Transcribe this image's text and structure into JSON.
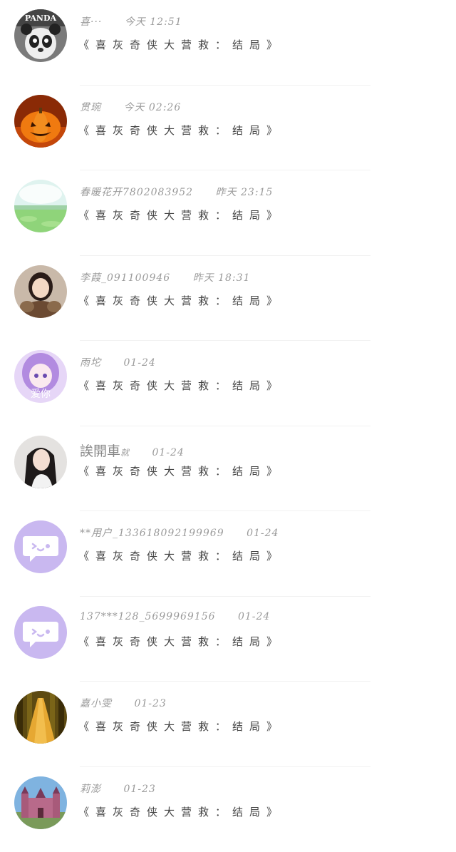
{
  "items": [
    {
      "name": "喜···",
      "time": "今天 12:51",
      "title": "《喜灰奇侠大营救：结局》",
      "avatar_icon": "panda-avatar-icon",
      "avatar_text": "PANDA"
    },
    {
      "name": "贯琬",
      "time": "今天 02:26",
      "title": "《喜灰奇侠大营救：结局》",
      "avatar_icon": "pumpkin-avatar-icon"
    },
    {
      "name": "春暖花开7802083952",
      "time": "昨天 23:15",
      "title": "《喜灰奇侠大营救：结局》",
      "avatar_icon": "meadow-avatar-icon"
    },
    {
      "name": "李葭_091100946",
      "time": "昨天 18:31",
      "title": "《喜灰奇侠大营救：结局》",
      "avatar_icon": "girl-photo-avatar-icon"
    },
    {
      "name": "雨坨",
      "time": "01-24",
      "title": "《喜灰奇侠大营救：结局》",
      "avatar_icon": "anime-girl-avatar-icon",
      "avatar_text": "爱你"
    },
    {
      "name": "誒開車",
      "name_suffix": "就",
      "time": "01-24",
      "title": "《喜灰奇侠大营救：结局》",
      "avatar_icon": "woman-photo-avatar-icon"
    },
    {
      "name": "**用户_133618092199969",
      "time": "01-24",
      "title": "《喜灰奇侠大营救：结局》",
      "avatar_icon": "chat-bubble-avatar-icon"
    },
    {
      "name": "137***128_5699969156",
      "time": "01-24",
      "title": "《喜灰奇侠大营救：结局》",
      "avatar_icon": "chat-bubble-avatar-icon"
    },
    {
      "name": "嘉小雯",
      "time": "01-23",
      "title": "《喜灰奇侠大营救：结局》",
      "avatar_icon": "forest-path-avatar-icon"
    },
    {
      "name": "莉澎",
      "time": "01-23",
      "title": "《喜灰奇侠大营救：结局》",
      "avatar_icon": "castle-avatar-icon"
    }
  ],
  "colors": {
    "text_primary": "#444444",
    "text_secondary": "#9a9a9a",
    "divider": "#f1f1f1",
    "default_avatar": "#c9b8f0"
  }
}
